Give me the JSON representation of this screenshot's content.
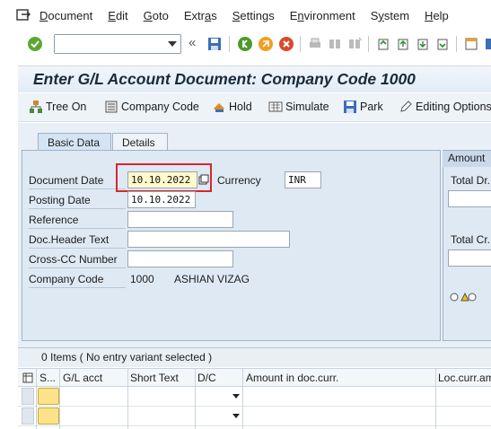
{
  "menu": {
    "items": [
      {
        "label": "Document",
        "u": "D",
        "rest": "ocument"
      },
      {
        "label": "Edit",
        "u": "E",
        "rest": "dit"
      },
      {
        "label": "Goto",
        "u": "G",
        "rest": "oto"
      },
      {
        "label": "Extras",
        "pre": "Extr",
        "u": "a",
        "rest": "s"
      },
      {
        "label": "Settings",
        "u": "S",
        "rest": "ettings"
      },
      {
        "label": "Environment",
        "pre": "E",
        "u": "n",
        "rest": "vironment"
      },
      {
        "label": "System",
        "pre": "S",
        "u": "y",
        "rest": "stem"
      },
      {
        "label": "Help",
        "u": "H",
        "rest": "elp"
      }
    ]
  },
  "toolbar": {
    "command_value": "",
    "back_glyph": "«"
  },
  "title": "Enter G/L Account Document: Company Code 1000",
  "app_toolbar": {
    "tree_on": "Tree On",
    "company_code": "Company Code",
    "hold": "Hold",
    "simulate": "Simulate",
    "park": "Park",
    "editing_options": "Editing Options"
  },
  "tabs": {
    "basic_data": "Basic Data",
    "details": "Details"
  },
  "form": {
    "document_date_label": "Document Date",
    "document_date": "10.10.2022",
    "currency_label": "Currency",
    "currency": "INR",
    "posting_date_label": "Posting Date",
    "posting_date": "10.10.2022",
    "reference_label": "Reference",
    "reference": "",
    "doc_header_label": "Doc.Header Text",
    "doc_header": "",
    "cross_cc_label": "Cross-CC Number",
    "cross_cc": "",
    "company_code_label": "Company Code",
    "company_code": "1000",
    "company_name": "ASHIAN VIZAG"
  },
  "amount_panel": {
    "header": "Amount",
    "total_dr_label": "Total Dr.",
    "total_cr_label": "Total Cr."
  },
  "items": {
    "summary": "0 Items ( No entry variant selected )",
    "columns": [
      "S...",
      "G/L acct",
      "Short Text",
      "D/C",
      "Amount in doc.curr.",
      "Loc.curr.am"
    ]
  },
  "colors": {
    "highlight": "#d9262a",
    "status_yellow": "#fce38a"
  }
}
